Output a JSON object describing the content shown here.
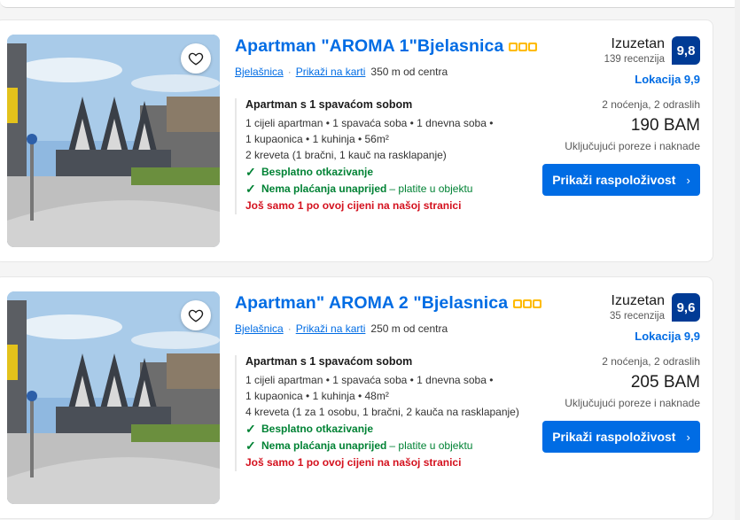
{
  "listings": [
    {
      "title": "Apartman \"AROMA 1\"Bjelasnica",
      "stars": 3,
      "location_link": "Bjelašnica",
      "map_link": "Prikaži na karti",
      "distance": "350 m od centra",
      "room_title": "Apartman s 1 spavaćom sobom",
      "details": [
        "1 cijeli apartman • 1 spavaća soba • 1 dnevna soba •",
        "1 kupaonica • 1 kuhinja • 56m²",
        "2 kreveta (1 bračni, 1 kauč na rasklapanje)"
      ],
      "free_cancel": "Besplatno otkazivanje",
      "no_prepay": "Nema plaćanja unaprijed",
      "no_prepay_rest": "– platite u objektu",
      "urgency": "Još samo 1 po ovoj cijeni na našoj stranici",
      "review_label": "Izuzetan",
      "review_count": "139 recenzija",
      "score": "9,8",
      "location_score": "Lokacija 9,9",
      "guests": "2 noćenja, 2 odraslih",
      "price": "190 BAM",
      "taxes": "Uključujući poreze i naknade",
      "button": "Prikaži raspoloživost"
    },
    {
      "title": "Apartman\" AROMA 2 \"Bjelasnica",
      "stars": 3,
      "location_link": "Bjelašnica",
      "map_link": "Prikaži na karti",
      "distance": "250 m od centra",
      "room_title": "Apartman s 1 spavaćom sobom",
      "details": [
        "1 cijeli apartman • 1 spavaća soba • 1 dnevna soba •",
        "1 kupaonica • 1 kuhinja • 48m²",
        "4 kreveta (1 za 1 osobu, 1 bračni, 2 kauča na rasklapanje)"
      ],
      "free_cancel": "Besplatno otkazivanje",
      "no_prepay": "Nema plaćanja unaprijed",
      "no_prepay_rest": "– platite u objektu",
      "urgency": "Još samo 1 po ovoj cijeni na našoj stranici",
      "review_label": "Izuzetan",
      "review_count": "35 recenzija",
      "score": "9,6",
      "location_score": "Lokacija 9,9",
      "guests": "2 noćenja, 2 odraslih",
      "price": "205 BAM",
      "taxes": "Uključujući poreze i naknade",
      "button": "Prikaži raspoloživost"
    }
  ],
  "colors": {
    "link": "#006ce4",
    "score_bg": "#003b95",
    "success": "#008234",
    "urgency": "#d4111e",
    "star": "#febb02"
  },
  "icons": {
    "favorite": "heart-icon",
    "check": "checkmark-icon",
    "button_arrow": "chevron-right-icon"
  }
}
